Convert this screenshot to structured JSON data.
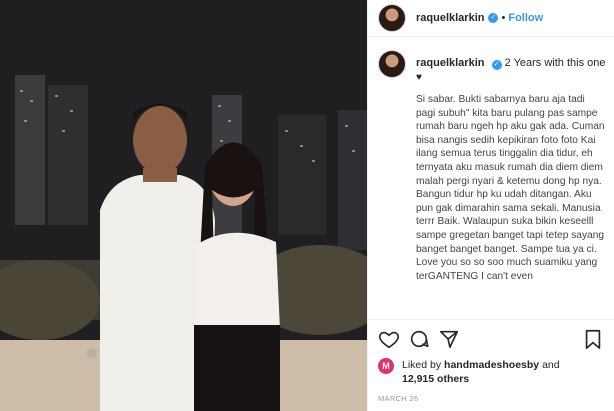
{
  "post": {
    "username": "raquelklarkin",
    "follow_label": "Follow",
    "separator": "•",
    "caption_head": "2 Years with this one",
    "caption_heart": "♥",
    "caption_body": "Si sabar. Bukti sabarnya baru aja tadi pagi subuh\" kita baru pulang pas sampe rumah baru ngeh hp aku gak ada. Cuman bisa nangis sedih kepikiran foto foto Kai ilang semua terus tinggalin dia tidur, eh ternyata aku masuk rumah dia diem diem malah pergi nyari & ketemu dong hp nya. Bangun tidur hp ku udah ditangan. Aku pun gak dimarahin sama sekali. Manusia terrr Baik. Walaupun suka bikin keseelll sampe gregetan banget tapi tetep sayang banget banget banget. Sampe tua ya ci. Love you so so soo much suamiku yang terGANTENG I can't even",
    "likes_prefix": "Liked by",
    "likes_user": "handmadeshoesby",
    "likes_and": "and",
    "likes_count": "12,915 others",
    "date": "MARCH 26"
  },
  "icons": {
    "verified": "verified-badge-icon",
    "like": "heart-icon",
    "comment": "comment-icon",
    "share": "share-icon",
    "save": "bookmark-icon",
    "liker_avatar": "M"
  },
  "colors": {
    "link": "#3897f0",
    "verified": "#3897f0",
    "liker_avatar_bg": "#e1306c"
  }
}
